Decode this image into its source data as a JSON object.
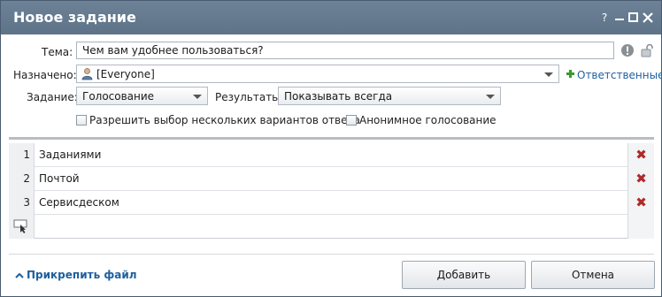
{
  "window": {
    "title": "Новое задание",
    "help_label": "?",
    "min_label": "–",
    "max_label": "☐",
    "close_label": "✕"
  },
  "form": {
    "subject": {
      "label": "Тема:",
      "value": "Чем вам удобнее пользоваться?"
    },
    "assigned": {
      "label": "Назначено:",
      "value": "[Everyone]",
      "responsibles_link": "Ответственные"
    },
    "task": {
      "label": "Задание:",
      "value": "Голосование"
    },
    "results": {
      "label": "Результаты:",
      "value": "Показывать всегда"
    },
    "options": {
      "multiple": "Разрешить выбор нескольких вариантов ответа",
      "anonymous": "Анонимное голосование"
    }
  },
  "answers": [
    {
      "num": "1",
      "text": "Заданиями"
    },
    {
      "num": "2",
      "text": "Почтой"
    },
    {
      "num": "3",
      "text": "Сервисдеском"
    }
  ],
  "footer": {
    "attach": "Прикрепить файл",
    "add_button": "Добавить",
    "cancel_button": "Отмена"
  },
  "icons": {
    "warning": "warning-icon",
    "lock": "lock-icon",
    "user": "user-icon",
    "add": "plus-icon",
    "delete": "delete-icon",
    "new_row": "cursor-icon"
  },
  "colors": {
    "titlebar": "#5e7388",
    "link": "#1f5f9e",
    "delete": "#b02a2a",
    "add_green": "#3a9a2e"
  }
}
